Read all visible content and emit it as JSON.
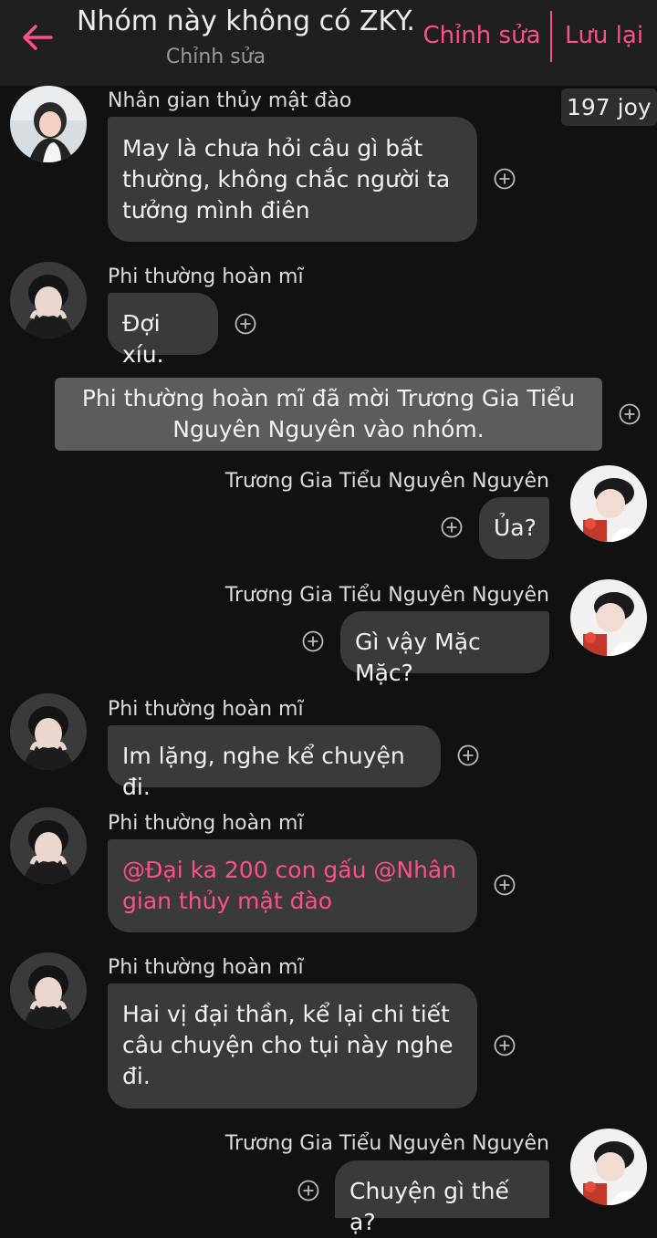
{
  "header": {
    "title": "Nhóm này không có ZKY...",
    "subtitle": "Chỉnh sửa",
    "edit_label": "Chỉnh sửa",
    "save_label": "Lưu lại",
    "back_icon": "arrow-left-icon"
  },
  "joy_badge": "197 joy",
  "colors": {
    "accent": "#ff4f8b",
    "background": "#111111",
    "bubble": "#3a3a3a",
    "system_bubble": "#5c5c5c"
  },
  "messages": [
    {
      "sender": "Nhân gian thủy mật đào",
      "side": "left",
      "text": "May là chưa hỏi câu gì bất thường, không chắc người ta tưởng mình điên"
    },
    {
      "sender": "Phi thường hoàn mĩ",
      "side": "left",
      "text": "Đợi xíu."
    },
    {
      "type": "system",
      "text": "Phi thường hoàn mĩ đã mời Trương Gia Tiểu Nguyên Nguyên vào nhóm."
    },
    {
      "sender": "Trương Gia Tiểu Nguyên Nguyên",
      "side": "right",
      "text": "Ủa?"
    },
    {
      "sender": "Trương Gia Tiểu Nguyên Nguyên",
      "side": "right",
      "text": "Gì vậy Mặc Mặc?"
    },
    {
      "sender": "Phi thường hoàn mĩ",
      "side": "left",
      "text": "Im lặng, nghe kể chuyện đi."
    },
    {
      "sender": "Phi thường hoàn mĩ",
      "side": "left",
      "text": "@Đại ka 200 con gấu @Nhân gian thủy mật đào"
    },
    {
      "sender": "Phi thường hoàn mĩ",
      "side": "left",
      "text": "Hai vị đại thần, kể lại chi tiết câu chuyện cho tụi này nghe đi."
    },
    {
      "sender": "Trương Gia Tiểu Nguyên Nguyên",
      "side": "right",
      "text": "Chuyện gì thế ạ?"
    }
  ]
}
